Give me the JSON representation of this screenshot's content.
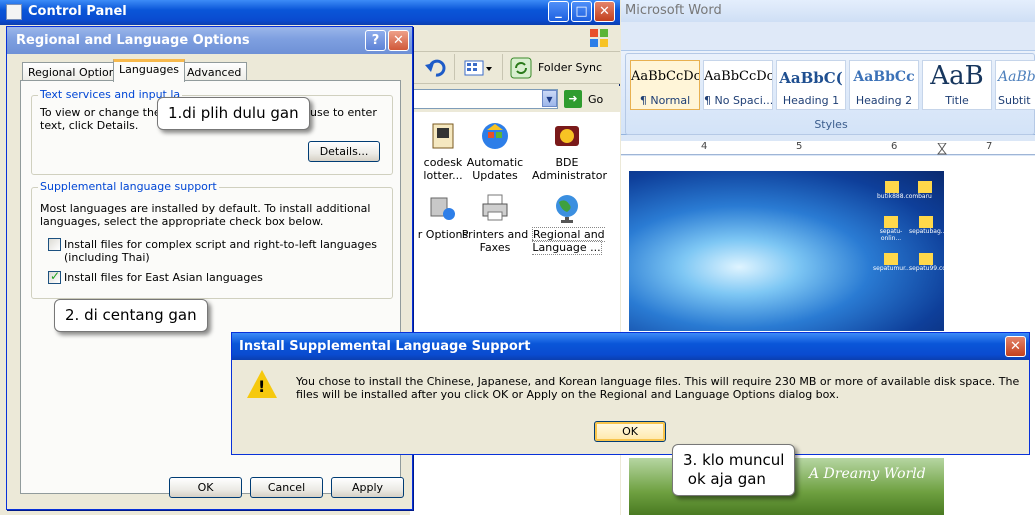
{
  "control_panel": {
    "title": "Control Panel",
    "toolbar": {
      "folder_sync": "Folder Sync"
    },
    "address": {
      "go": "Go"
    },
    "items": [
      {
        "label": "codesk\nlotter...",
        "icon": "autodesk-plotter-icon"
      },
      {
        "label": "Automatic\nUpdates",
        "icon": "automatic-updates-icon"
      },
      {
        "label": "BDE\nAdministrator",
        "icon": "bde-administrator-icon"
      },
      {
        "label": "r Options",
        "icon": "options-icon"
      },
      {
        "label": "Printers and\nFaxes",
        "icon": "printer-icon"
      },
      {
        "label": "Regional and\nLanguage ...",
        "icon": "globe-icon"
      }
    ]
  },
  "regional_dialog": {
    "title": "Regional and Language Options",
    "help": "?",
    "close": "✕",
    "tabs": [
      "Regional Options",
      "Languages",
      "Advanced"
    ],
    "active_tab": "Languages",
    "text_services": {
      "legend": "Text services and input la",
      "desc_line1": "To view or change the la",
      "desc_line1_tail": "use to enter",
      "desc_line2": "text, click Details.",
      "details_button": "Details..."
    },
    "supplemental": {
      "legend": "Supplemental language support",
      "desc": "Most languages are installed by default. To install additional languages, select the appropriate check box below.",
      "complex_script": {
        "label": "Install files for complex script and right-to-left languages (including Thai)",
        "checked": false
      },
      "east_asian": {
        "label": "Install files for East Asian languages",
        "checked": true
      }
    },
    "buttons": {
      "ok": "OK",
      "cancel": "Cancel",
      "apply": "Apply"
    }
  },
  "word": {
    "title": "Microsoft Word",
    "styles": [
      {
        "preview": "AaBbCcDc",
        "name": "¶ Normal",
        "selected": true
      },
      {
        "preview": "AaBbCcDc",
        "name": "¶ No Spaci...",
        "selected": false
      },
      {
        "preview": "AaBbC(",
        "name": "Heading 1",
        "selected": false
      },
      {
        "preview": "AaBbCc",
        "name": "Heading 2",
        "selected": false
      },
      {
        "preview": "AaB",
        "name": "Title",
        "selected": false
      },
      {
        "preview": "AaBb",
        "name": "Subtit",
        "selected": false
      }
    ],
    "styles_group_label": "Styles",
    "ruler_marks": [
      "4",
      "5",
      "6",
      "7"
    ],
    "desktop_icons": [
      "butik888.com",
      "baru",
      "sepatu-onlin...",
      "sepatubag...",
      "sepatumur...",
      "sepatu99.com"
    ],
    "image_caption": "A Dreamy World"
  },
  "install_dialog": {
    "title": "Install Supplemental Language Support",
    "message": "You chose to install the Chinese, Japanese, and Korean language files. This will require 230 MB or more of available disk space. The files will be installed after you click OK or Apply on the Regional and Language Options dialog box.",
    "ok": "OK"
  },
  "callouts": {
    "step1": "1.di plih dulu gan",
    "step2": "2. di centang gan",
    "step3": "3. klo muncul\n ok aja gan"
  },
  "colors": {
    "xp_title_blue": "#0a56d8",
    "warning_yellow": "#f6c90e",
    "close_red": "#c2401e"
  }
}
